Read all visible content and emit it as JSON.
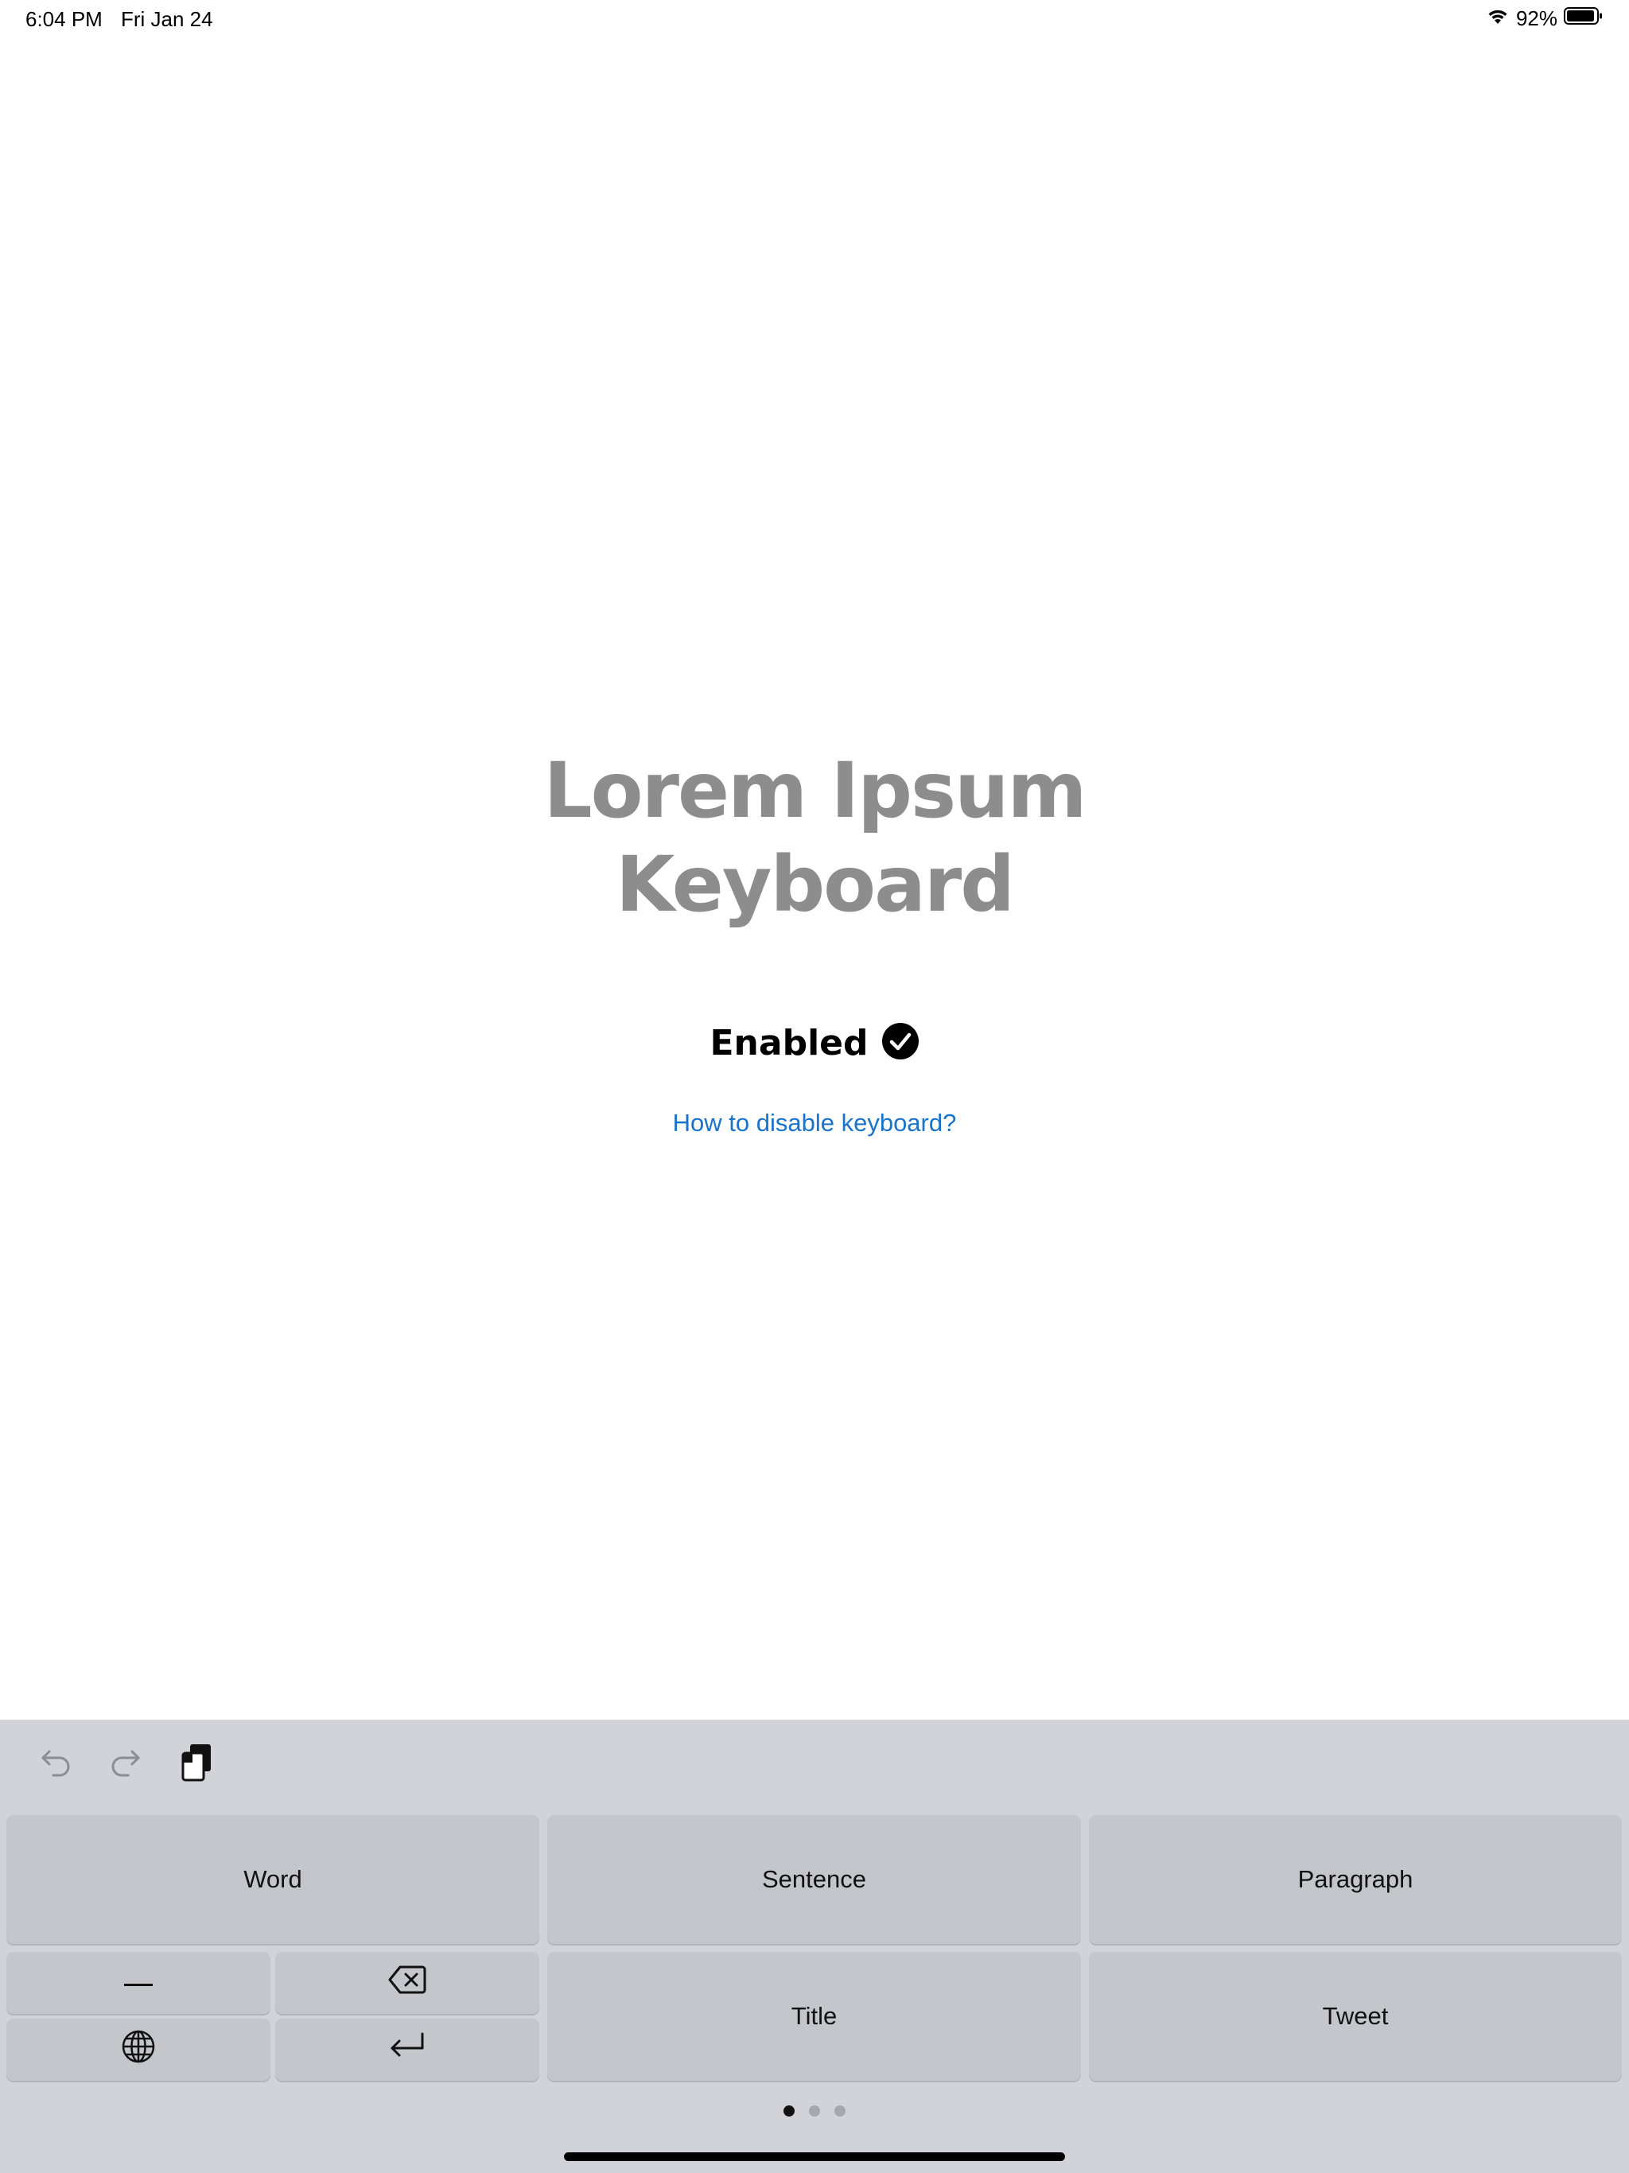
{
  "status_bar": {
    "time": "6:04 PM",
    "date": "Fri Jan 24",
    "battery_percent": "92%",
    "battery_level": 0.92
  },
  "hero": {
    "title_line1": "Lorem Ipsum",
    "title_line2": "Keyboard"
  },
  "keyboard_status": {
    "label": "Enabled",
    "link": "How to disable keyboard?"
  },
  "keyboard": {
    "toolbar": {
      "undo_icon": "undo-arrow-icon",
      "redo_icon": "redo-arrow-icon",
      "clipboard_icon": "clipboard-icon"
    },
    "keys": {
      "word": "Word",
      "sentence": "Sentence",
      "paragraph": "Paragraph",
      "title": "Title",
      "tweet": "Tweet",
      "dash_icon": "dash-icon",
      "delete_icon": "delete-backward-icon",
      "globe_icon": "globe-icon",
      "return_icon": "return-icon"
    },
    "pages": {
      "count": 3,
      "current": 1
    }
  },
  "colors": {
    "link": "#1a73c9",
    "keyboard_bg": "#d1d3d9",
    "key_bg": "#c5c6cc",
    "title_gray": "#8d8d8d"
  }
}
